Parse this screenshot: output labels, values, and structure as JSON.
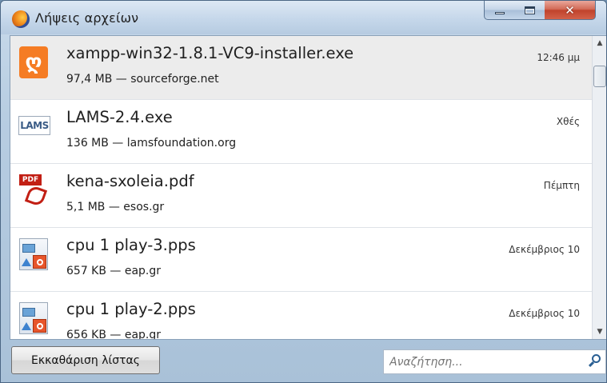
{
  "window": {
    "title": "Λήψεις αρχείων",
    "app_icon": "firefox-icon",
    "controls": {
      "minimize": "minimize-icon",
      "maximize": "maximize-icon",
      "close": "close-icon"
    }
  },
  "downloads": [
    {
      "name": "xampp-win32-1.8.1-VC9-installer.exe",
      "details": "97,4 MB — sourceforge.net",
      "time": "12:46 μμ",
      "icon": "xampp-icon",
      "selected": true
    },
    {
      "name": "LAMS-2.4.exe",
      "details": "136 MB — lamsfoundation.org",
      "time": "Χθές",
      "icon": "lams-icon"
    },
    {
      "name": "kena-sxoleia.pdf",
      "details": "5,1 MB — esos.gr",
      "time": "Πέμπτη",
      "icon": "pdf-icon"
    },
    {
      "name": "cpu 1 play-3.pps",
      "details": "657 KB — eap.gr",
      "time": "Δεκέμβριος 10",
      "icon": "pps-icon"
    },
    {
      "name": "cpu 1 play-2.pps",
      "details": "656 KB — eap.gr",
      "time": "Δεκέμβριος 10",
      "icon": "pps-icon"
    }
  ],
  "footer": {
    "clear_button": "Εκκαθάριση λίστας",
    "search_placeholder": "Αναζήτηση...",
    "search_icon": "magnifier-icon"
  }
}
